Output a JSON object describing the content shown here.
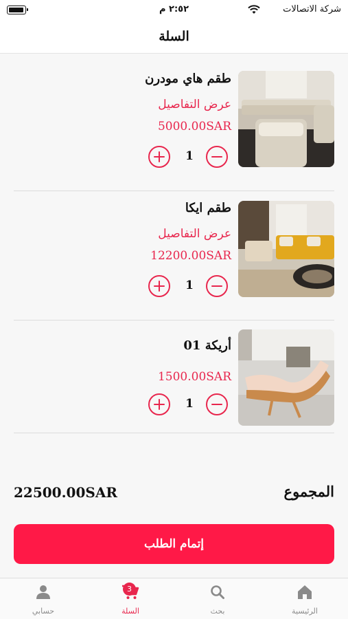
{
  "status_bar": {
    "carrier": "شركة الاتصالات",
    "time": "٢:٥٢ م"
  },
  "header": {
    "title": "السلة"
  },
  "cart": {
    "details_label": "عرض التفاصيل",
    "items": [
      {
        "name": "طقم هاي مودرن",
        "price": "5000.00SAR",
        "quantity": "1",
        "image": "modern-sofa-set-photo"
      },
      {
        "name": "طقم ايكا",
        "price": "12200.00SAR",
        "quantity": "1",
        "image": "ikea-sofa-set-photo"
      },
      {
        "name": "أريكة 01",
        "price": "1500.00SAR",
        "quantity": "1",
        "image": "lounge-chair-photo"
      }
    ]
  },
  "summary": {
    "total_label": "المجموع",
    "total_amount": "22500.00SAR",
    "checkout_label": "إتمام الطلب"
  },
  "tab_bar": {
    "tabs": [
      {
        "label": "الرئيسية",
        "icon": "home-icon"
      },
      {
        "label": "بحث",
        "icon": "search-icon"
      },
      {
        "label": "السلة",
        "icon": "cart-icon",
        "badge": "3",
        "active": true
      },
      {
        "label": "حسابي",
        "icon": "user-icon"
      }
    ]
  },
  "colors": {
    "accent": "#e8264d",
    "button": "#ff1947"
  }
}
